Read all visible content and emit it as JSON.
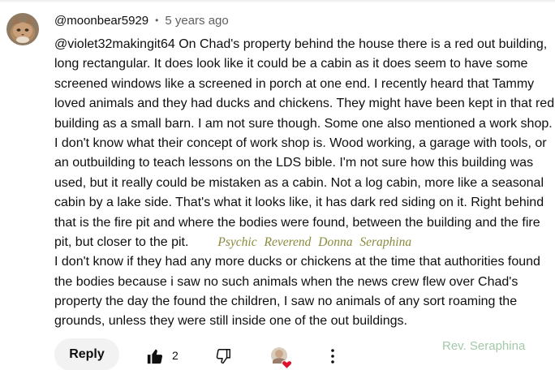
{
  "comment": {
    "author": "@moonbear5929",
    "separator": "•",
    "time": "5 years ago",
    "lines": [
      "@violet32makingit64 On Chad's property behind the house there is a red out building,",
      "long rectangular. It does look like it could be a cabin as it does seem to have some",
      "screened windows like a screened in porch at one end. I recently heard that Tammy",
      "loved animals and they had ducks and chickens. They might have been kept in that red",
      "building as a small barn. I am not sure though. Some one also mentioned a work shop.",
      "I don't know what their concept of work shop is. Wood working, a garage with tools, or",
      "an outbuilding to teach lessons on the LDS bible. I'm not sure how this building was",
      "used, but it really could be mistaken as a cabin. Not a log cabin, more like a seasonal",
      "cabin by a lake side. That's what it looks like, it has dark red siding on it. Right behind",
      "that is the fire pit and where the bodies were found, between the building and the fire",
      "pit, but closer to the pit.",
      "I don't know if they had any more ducks or chickens at the time that authorities found",
      "the bodies because i saw no such animals when the news crew flew over Chad's",
      "property the day the found the children, I saw no animals of any sort roaming the",
      "grounds, unless they were still inside one of the out buildings."
    ]
  },
  "watermark": {
    "inline": "Psychic Reverend Donna Seraphina",
    "corner": "Rev. Seraphina"
  },
  "actions": {
    "reply_label": "Reply",
    "like_count": "2",
    "like_icon": "thumbs-up-icon",
    "dislike_icon": "thumbs-down-icon",
    "heart_icon": "creator-heart-icon",
    "more_icon": "more-vert-icon"
  },
  "colors": {
    "text": "#0f0f0f",
    "secondary": "#606060",
    "reply_bg": "#f2f2f2",
    "heart": "#e0112b",
    "watermark_inline": "#8a8a3c",
    "watermark_corner": "#a3c9a8"
  }
}
